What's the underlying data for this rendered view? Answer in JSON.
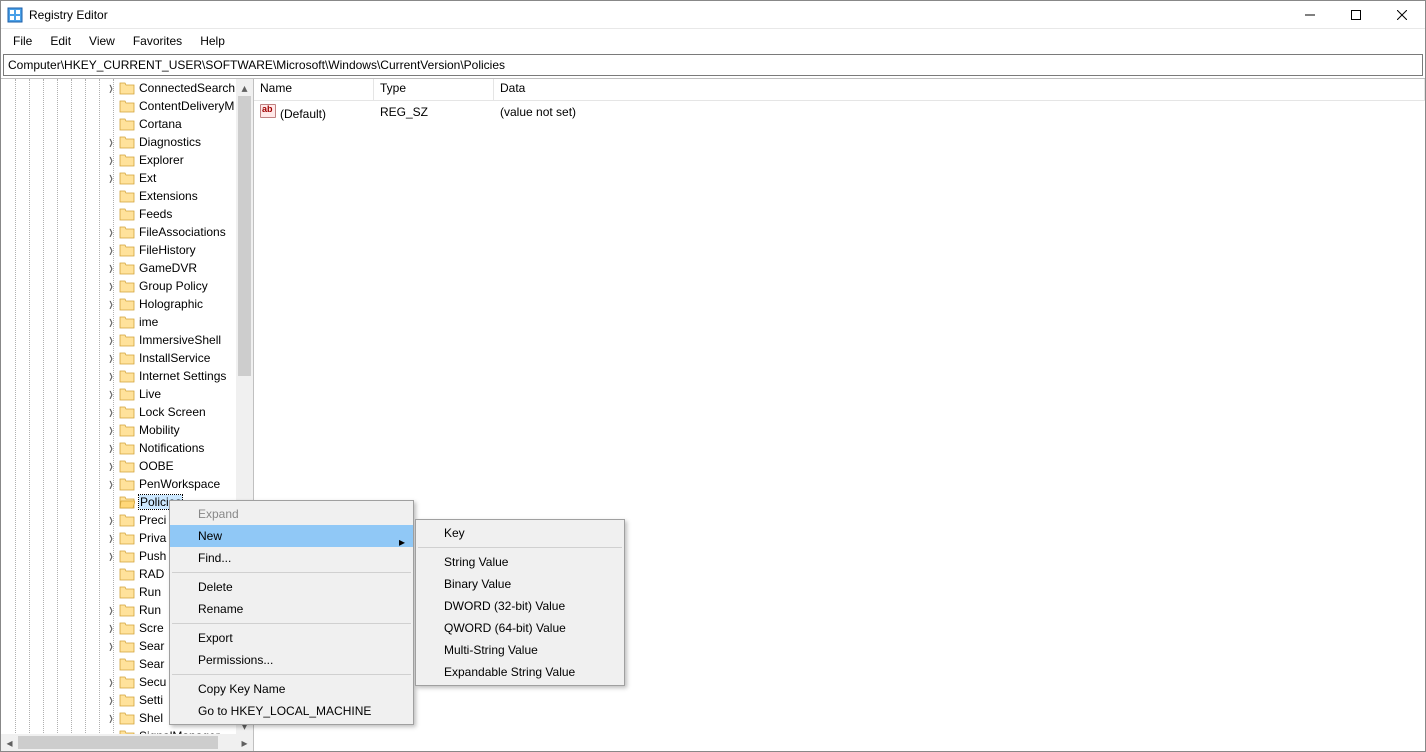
{
  "window_title": "Registry Editor",
  "menu": {
    "file": "File",
    "edit": "Edit",
    "view": "View",
    "favorites": "Favorites",
    "help": "Help"
  },
  "address": "Computer\\HKEY_CURRENT_USER\\SOFTWARE\\Microsoft\\Windows\\CurrentVersion\\Policies",
  "list": {
    "columns": {
      "name": "Name",
      "type": "Type",
      "data": "Data"
    },
    "row0": {
      "name": "(Default)",
      "type": "REG_SZ",
      "data": "(value not set)"
    }
  },
  "tree": {
    "n0": "ConnectedSearch",
    "n1": "ContentDeliveryM",
    "n2": "Cortana",
    "n3": "Diagnostics",
    "n4": "Explorer",
    "n5": "Ext",
    "n6": "Extensions",
    "n7": "Feeds",
    "n8": "FileAssociations",
    "n9": "FileHistory",
    "n10": "GameDVR",
    "n11": "Group Policy",
    "n12": "Holographic",
    "n13": "ime",
    "n14": "ImmersiveShell",
    "n15": "InstallService",
    "n16": "Internet Settings",
    "n17": "Live",
    "n18": "Lock Screen",
    "n19": "Mobility",
    "n20": "Notifications",
    "n21": "OOBE",
    "n22": "PenWorkspace",
    "n23": "Policies",
    "n24": "Preci",
    "n25": "Priva",
    "n26": "Push",
    "n27": "RAD",
    "n28": "Run",
    "n29": "Run",
    "n30": "Scre",
    "n31": "Sear",
    "n32": "Sear",
    "n33": "Secu",
    "n34": "Setti",
    "n35": "Shel",
    "n36": "SignalManager"
  },
  "tree_expand": [
    "n0",
    "n3",
    "n4",
    "n5",
    "n8",
    "n9",
    "n10",
    "n11",
    "n12",
    "n13",
    "n14",
    "n15",
    "n16",
    "n17",
    "n18",
    "n19",
    "n20",
    "n21",
    "n22",
    "n24",
    "n25",
    "n26",
    "n29",
    "n30",
    "n31",
    "n33",
    "n34",
    "n35"
  ],
  "ctx": {
    "expand": "Expand",
    "new": "New",
    "find": "Find...",
    "delete": "Delete",
    "rename": "Rename",
    "export": "Export",
    "permissions": "Permissions...",
    "copykey": "Copy Key Name",
    "goto": "Go to HKEY_LOCAL_MACHINE"
  },
  "submenu": {
    "key": "Key",
    "string": "String Value",
    "binary": "Binary Value",
    "dword": "DWORD (32-bit) Value",
    "qword": "QWORD (64-bit) Value",
    "multi": "Multi-String Value",
    "expand": "Expandable String Value"
  }
}
